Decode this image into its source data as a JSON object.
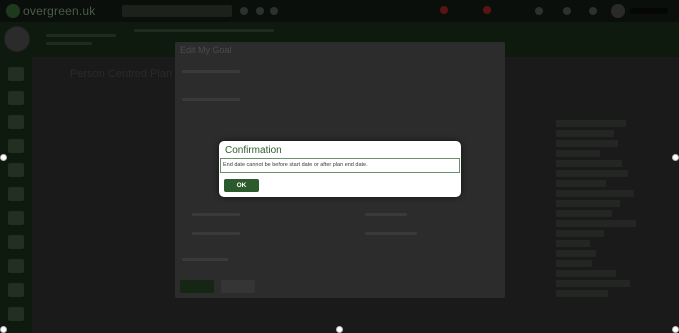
{
  "app": {
    "logo_text": "overgreen.uk"
  },
  "background": {
    "page_title": "Person Centred Plan",
    "goal_dialog_title": "Edit My Goal"
  },
  "confirmation": {
    "title": "Confirmation",
    "message": "End date cannot be before start date or after plan end date.",
    "ok_label": "OK"
  },
  "colors": {
    "accent": "#2d5a2d",
    "title": "#2f5f2f",
    "overlay": "#000000"
  }
}
